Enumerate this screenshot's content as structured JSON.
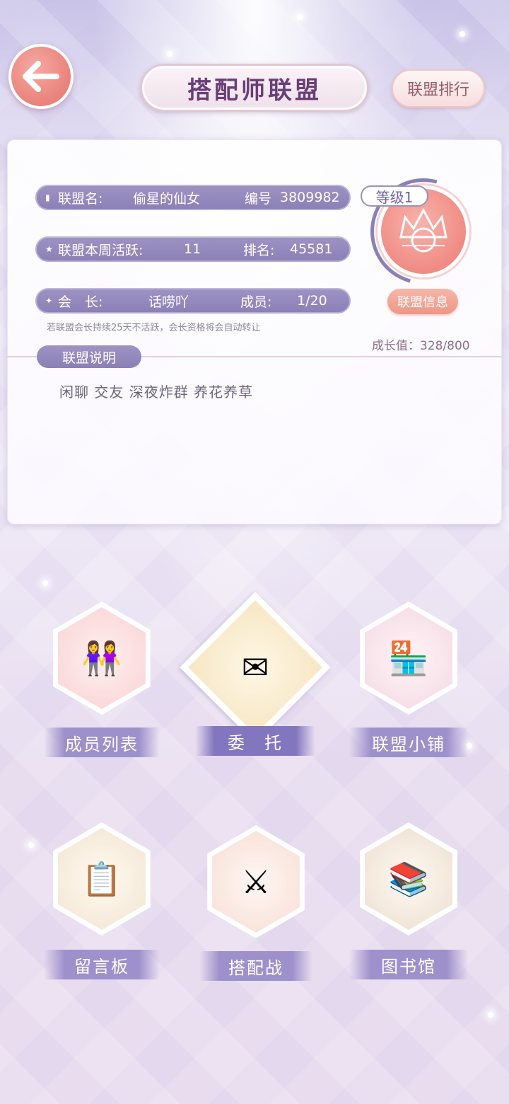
{
  "header": {
    "title": "搭配师联盟",
    "rank_button": "联盟排行"
  },
  "alliance": {
    "name_label": "联盟名:",
    "name": "偷星的仙女",
    "id_label": "编号",
    "id": "3809982",
    "activity_label": "联盟本周活跃:",
    "activity": "11",
    "ranking_label": "排名:",
    "ranking": "45581",
    "leader_label": "会　长:",
    "leader": "话唠吖",
    "members_label": "成员:",
    "members": "1/20",
    "note": "若联盟会长持续25天不活跃，会长资格将会自动转让",
    "level": "等级1",
    "info_button": "联盟信息",
    "growth": "成长值：328/800",
    "description_tag": "联盟说明",
    "description": "闲聊  交友  深夜炸群  养花养草"
  },
  "features": [
    {
      "label": "成员列表",
      "icon": "members-icon"
    },
    {
      "label": "委　托",
      "icon": "commission-icon"
    },
    {
      "label": "联盟小铺",
      "icon": "shop-icon"
    },
    {
      "label": "留言板",
      "icon": "message-board-icon"
    },
    {
      "label": "搭配战",
      "icon": "battle-icon"
    },
    {
      "label": "图书馆",
      "icon": "library-icon"
    }
  ],
  "colors": {
    "accent_purple": "#8a80b6",
    "accent_pink": "#ee9686",
    "title_text": "#6a3e78"
  }
}
